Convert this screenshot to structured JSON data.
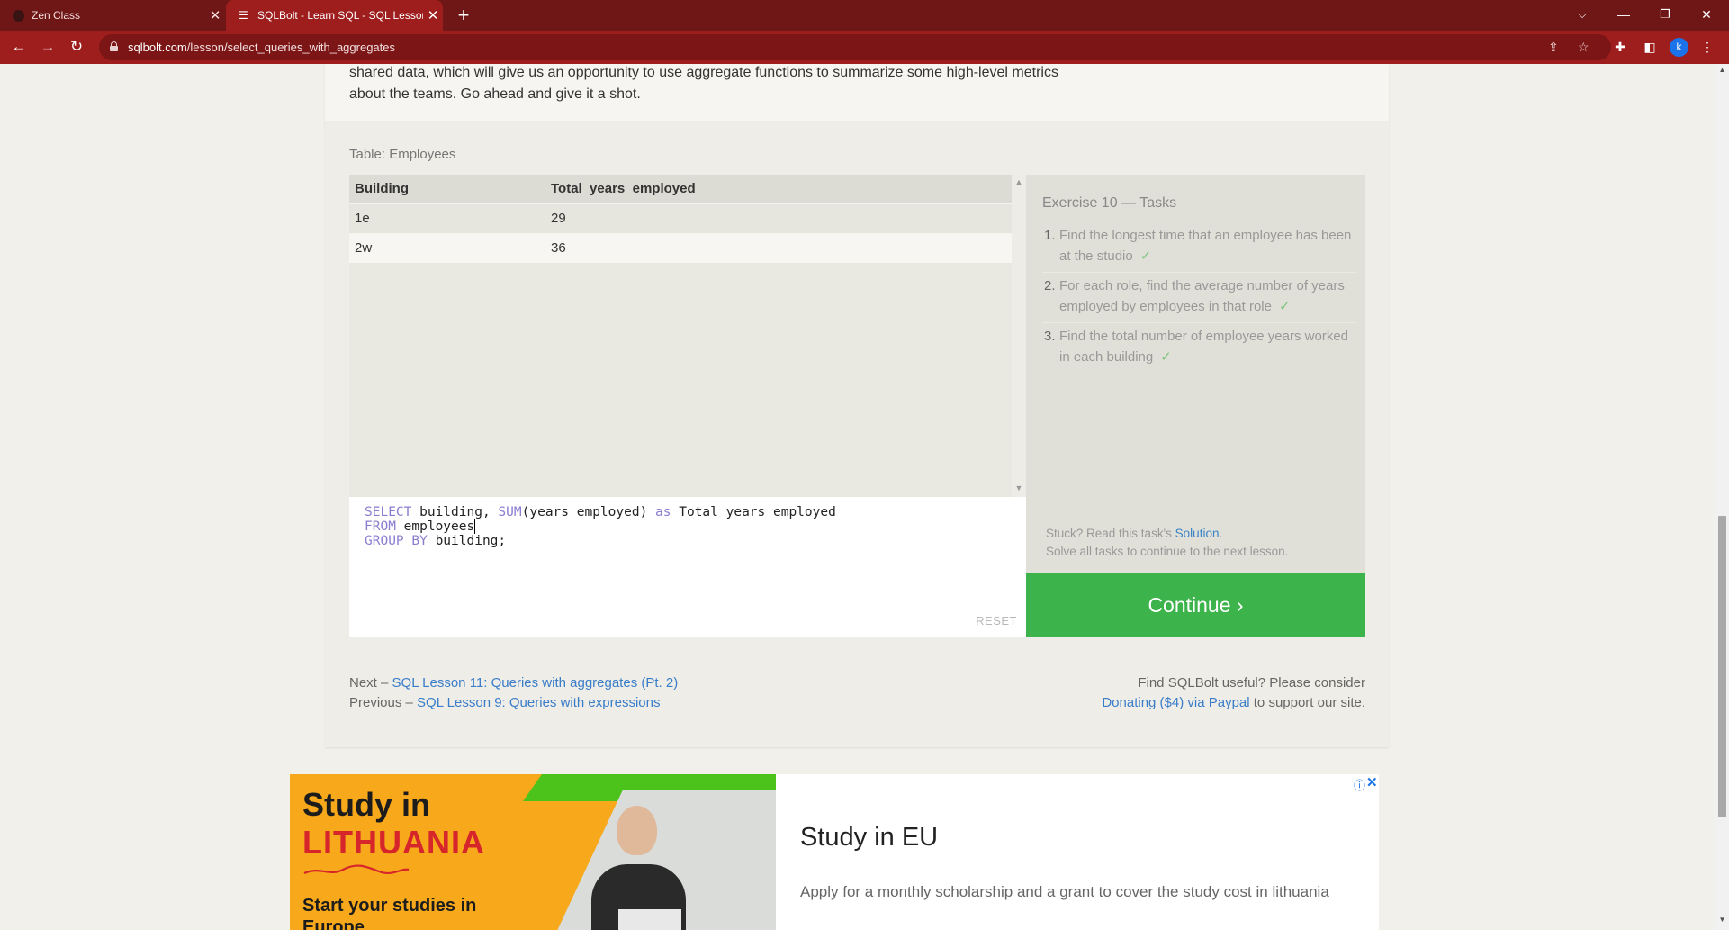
{
  "browser": {
    "tabs": [
      {
        "title": "Zen Class",
        "active": false
      },
      {
        "title": "SQLBolt - Learn SQL - SQL Lesson",
        "active": true
      }
    ],
    "url_host": "sqlbolt.com",
    "url_path": "/lesson/select_queries_with_aggregates",
    "profile_initial": "k"
  },
  "lesson": {
    "intro_text": "shared data, which will give us an opportunity to use aggregate functions to summarize some high-level metrics about the teams. Go ahead and give it a shot."
  },
  "results_table": {
    "caption": "Table: Employees",
    "columns": [
      "Building",
      "Total_years_employed"
    ],
    "rows": [
      [
        "1e",
        "29"
      ],
      [
        "2w",
        "36"
      ]
    ]
  },
  "editor": {
    "line1": {
      "kw1": "SELECT",
      "t1": " building, ",
      "fn": "SUM",
      "t2": "(years_employed) ",
      "kw2": "as",
      "t3": " Total_years_employed"
    },
    "line2": {
      "kw": "FROM",
      "t": " employees"
    },
    "line3": {
      "kw": "GROUP BY",
      "t": " building;"
    },
    "reset_label": "RESET"
  },
  "tasks": {
    "title": "Exercise 10 — Tasks",
    "items": [
      {
        "num": "1.",
        "text": "Find the longest time that an employee has been at the studio",
        "check": "✓"
      },
      {
        "num": "2.",
        "text": "For each role, find the average number of years employed by employees in that role",
        "check": "✓"
      },
      {
        "num": "3.",
        "text": "Find the total number of employee years worked in each building",
        "check": "✓"
      }
    ],
    "stuck_text": "Stuck? Read this task's",
    "solution_link": "Solution",
    "stuck_suffix": ".",
    "solve_all_text": "Solve all tasks to continue to the next lesson."
  },
  "continue_label": "Continue ›",
  "footer": {
    "next_prefix": "Next – ",
    "next_link": "SQL Lesson 11: Queries with aggregates (Pt. 2)",
    "prev_prefix": "Previous – ",
    "prev_link": "SQL Lesson 9: Queries with expressions",
    "support_text": "Find SQLBolt useful? Please consider",
    "donate_link": "Donating ($4) via Paypal",
    "support_suffix": " to support our site."
  },
  "ad": {
    "image_line1": "Study in",
    "image_line2": "LITHUANIA",
    "image_line3": "Start your studies in",
    "image_line4": "Europe",
    "title": "Study in EU",
    "description": "Apply for a monthly scholarship and a grant to cover the study cost in lithuania"
  }
}
